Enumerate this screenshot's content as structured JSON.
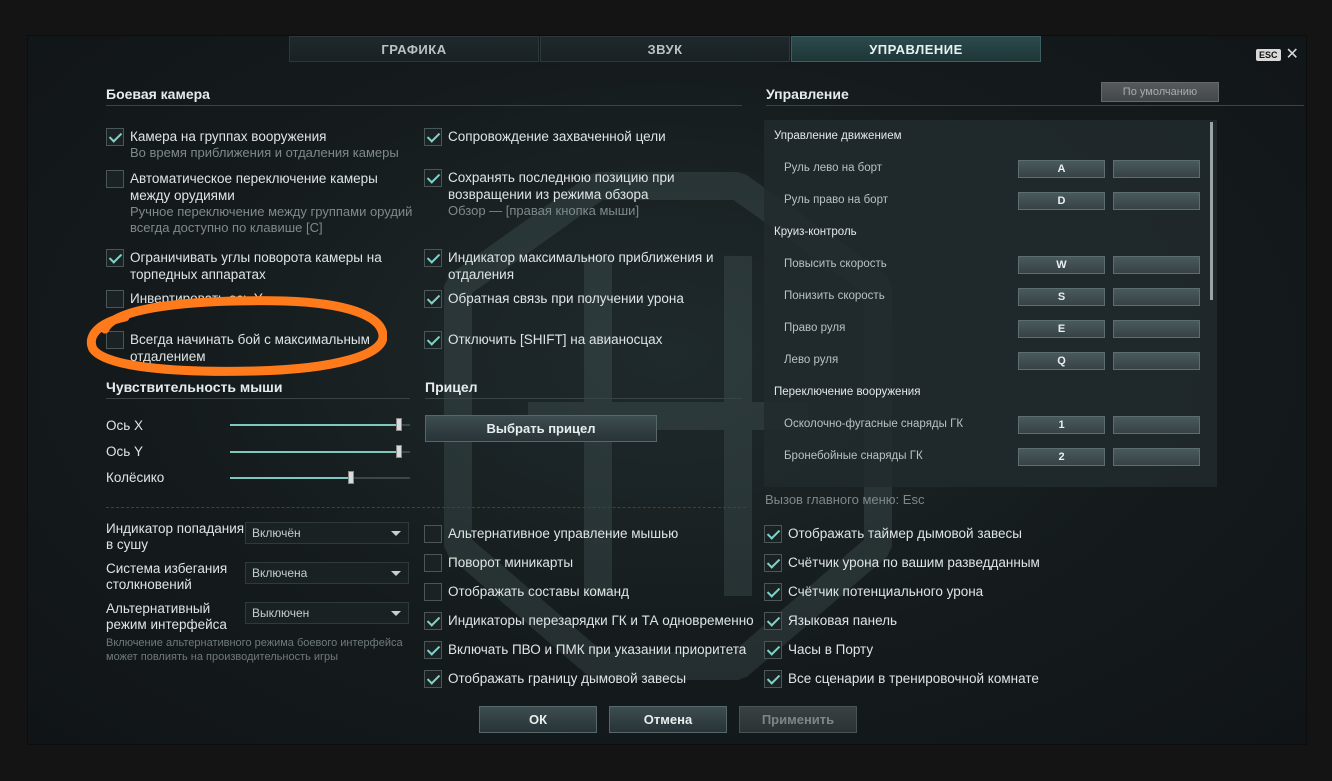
{
  "tabs": [
    "ГРАФИКА",
    "ЗВУК",
    "УПРАВЛЕНИЕ"
  ],
  "esc_label": "ESC",
  "close_glyph": "✕",
  "camera": {
    "title": "Боевая камера",
    "left": [
      {
        "label": "Камера на группах вооружения",
        "sub": "Во время приближения и отдаления камеры",
        "checked": true
      },
      {
        "label": "Автоматическое переключение камеры между орудиями",
        "sub": "Ручное переключение между группами орудий всегда доступно по клавише [C]",
        "checked": false
      },
      {
        "label": "Ограничивать углы поворота камеры на торпедных аппаратах",
        "sub": "",
        "checked": true
      },
      {
        "label": "Инвертировать ось Y",
        "sub": "",
        "checked": false
      },
      {
        "label": "Всегда начинать бой с максимальным отдалением",
        "sub": "",
        "checked": false
      }
    ],
    "right": [
      {
        "label": "Сопровождение захваченной цели",
        "sub": "",
        "checked": true
      },
      {
        "label": "Сохранять последнюю позицию при возвращении из режима обзора",
        "sub": "Обзор — [правая кнопка мыши]",
        "checked": true
      },
      {
        "label": "Индикатор максимального приближения и отдаления",
        "sub": "",
        "checked": true
      },
      {
        "label": "Обратная связь при получении урона",
        "sub": "",
        "checked": true
      },
      {
        "label": "Отключить [SHIFT] на авианосцах",
        "sub": "",
        "checked": true
      }
    ]
  },
  "mouse": {
    "title": "Чувствительность мыши",
    "sliders": [
      {
        "label": "Ось X",
        "value": 0.94
      },
      {
        "label": "Ось Y",
        "value": 0.94
      },
      {
        "label": "Колёсико",
        "value": 0.67
      }
    ]
  },
  "sight": {
    "title": "Прицел",
    "button": "Выбрать прицел"
  },
  "controls": {
    "title": "Управление",
    "default_button": "По умолчанию",
    "items": [
      {
        "type": "header",
        "label": "Управление движением"
      },
      {
        "type": "bind",
        "label": "Руль лево на борт",
        "key1": "A",
        "key2": ""
      },
      {
        "type": "bind",
        "label": "Руль право на борт",
        "key1": "D",
        "key2": ""
      },
      {
        "type": "header",
        "label": "Круиз-контроль"
      },
      {
        "type": "bind",
        "label": "Повысить скорость",
        "key1": "W",
        "key2": ""
      },
      {
        "type": "bind",
        "label": "Понизить скорость",
        "key1": "S",
        "key2": ""
      },
      {
        "type": "bind",
        "label": "Право руля",
        "key1": "E",
        "key2": ""
      },
      {
        "type": "bind",
        "label": "Лево руля",
        "key1": "Q",
        "key2": ""
      },
      {
        "type": "header",
        "label": "Переключение вооружения"
      },
      {
        "type": "bind",
        "label": "Осколочно-фугасные снаряды ГК",
        "key1": "1",
        "key2": ""
      },
      {
        "type": "bind",
        "label": "Бронебойные снаряды ГК",
        "key1": "2",
        "key2": ""
      }
    ],
    "footnote": "Вызов главного меню: Esc"
  },
  "dropdowns": [
    {
      "label": "Индикатор попадания в сушу",
      "value": "Включён"
    },
    {
      "label": "Система избегания столкновений",
      "value": "Включена"
    },
    {
      "label": "Альтернативный режим интерфейса",
      "value": "Выключен"
    }
  ],
  "dropdown_note": "Включение альтернативного режима боевого интерфейса может повлиять на производительность игры",
  "bottom_mid": [
    {
      "label": "Альтернативное управление мышью",
      "checked": false
    },
    {
      "label": "Поворот миникарты",
      "checked": false
    },
    {
      "label": "Отображать составы команд",
      "checked": false
    },
    {
      "label": "Индикаторы перезарядки ГК и ТА одновременно",
      "checked": true
    },
    {
      "label": "Включать ПВО и ПМК при указании приоритета",
      "checked": true
    },
    {
      "label": "Отображать границу дымовой завесы",
      "checked": true
    }
  ],
  "bottom_right": [
    {
      "label": "Отображать таймер дымовой завесы",
      "checked": true
    },
    {
      "label": "Счётчик урона по вашим разведданным",
      "checked": true
    },
    {
      "label": "Счётчик потенциального урона",
      "checked": true
    },
    {
      "label": "Языковая панель",
      "checked": true
    },
    {
      "label": "Часы в Порту",
      "checked": true
    },
    {
      "label": "Все сценарии в тренировочной комнате",
      "checked": true
    }
  ],
  "footer": {
    "ok": "ОК",
    "cancel": "Отмена",
    "apply": "Применить"
  },
  "colors": {
    "accent": "#7fd3c9",
    "annotation": "#ff7a1a",
    "active_tab": "#2c4a4c"
  }
}
